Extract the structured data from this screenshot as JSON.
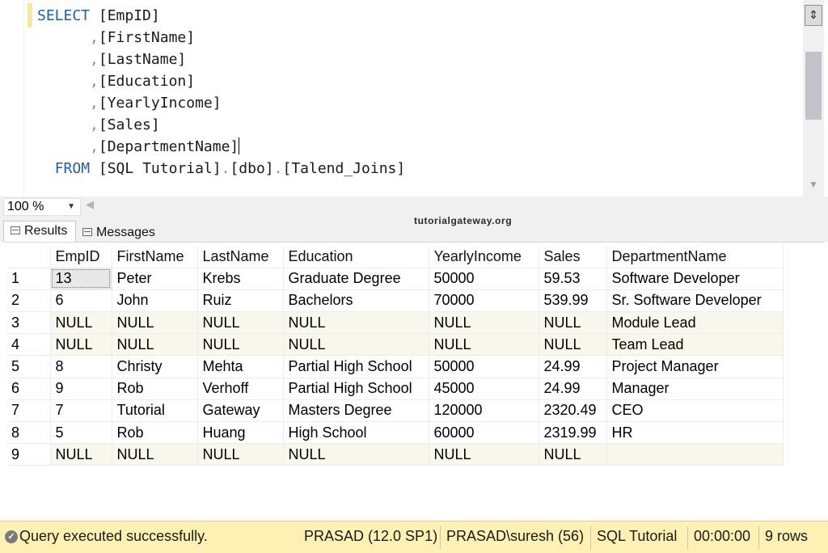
{
  "editor": {
    "lines": [
      [
        {
          "t": "SELECT",
          "c": "kw"
        },
        {
          "t": " [EmpID]",
          "c": ""
        }
      ],
      [
        {
          "t": "      ",
          "c": ""
        },
        {
          "t": ",",
          "c": "punct"
        },
        {
          "t": "[FirstName]",
          "c": ""
        }
      ],
      [
        {
          "t": "      ",
          "c": ""
        },
        {
          "t": ",",
          "c": "punct"
        },
        {
          "t": "[LastName]",
          "c": ""
        }
      ],
      [
        {
          "t": "      ",
          "c": ""
        },
        {
          "t": ",",
          "c": "punct"
        },
        {
          "t": "[Education]",
          "c": ""
        }
      ],
      [
        {
          "t": "      ",
          "c": ""
        },
        {
          "t": ",",
          "c": "punct"
        },
        {
          "t": "[YearlyIncome]",
          "c": ""
        }
      ],
      [
        {
          "t": "      ",
          "c": ""
        },
        {
          "t": ",",
          "c": "punct"
        },
        {
          "t": "[Sales]",
          "c": ""
        }
      ],
      [
        {
          "t": "      ",
          "c": ""
        },
        {
          "t": ",",
          "c": "punct"
        },
        {
          "t": "[DepartmentName]",
          "c": ""
        },
        {
          "t": "",
          "c": "caret"
        }
      ],
      [
        {
          "t": "  ",
          "c": ""
        },
        {
          "t": "FROM",
          "c": "kw"
        },
        {
          "t": " [SQL Tutorial]",
          "c": ""
        },
        {
          "t": ".",
          "c": "punct"
        },
        {
          "t": "[dbo]",
          "c": ""
        },
        {
          "t": ".",
          "c": "punct"
        },
        {
          "t": "[Talend_Joins]",
          "c": ""
        }
      ]
    ]
  },
  "zoom": {
    "value": "100 %"
  },
  "watermark": "tutorialgateway.org",
  "tabs": {
    "results": "Results",
    "messages": "Messages"
  },
  "grid": {
    "columns": [
      "EmpID",
      "FirstName",
      "LastName",
      "Education",
      "YearlyIncome",
      "Sales",
      "DepartmentName"
    ],
    "rows": [
      {
        "n": "1",
        "cells": [
          "13",
          "Peter",
          "Krebs",
          "Graduate Degree",
          "50000",
          "59.53",
          "Software Developer"
        ]
      },
      {
        "n": "2",
        "cells": [
          "6",
          "John",
          "Ruiz",
          "Bachelors",
          "70000",
          "539.99",
          "Sr. Software Developer"
        ]
      },
      {
        "n": "3",
        "cells": [
          "NULL",
          "NULL",
          "NULL",
          "NULL",
          "NULL",
          "NULL",
          "Module Lead"
        ]
      },
      {
        "n": "4",
        "cells": [
          "NULL",
          "NULL",
          "NULL",
          "NULL",
          "NULL",
          "NULL",
          "Team Lead"
        ]
      },
      {
        "n": "5",
        "cells": [
          "8",
          "Christy",
          "Mehta",
          "Partial High School",
          "50000",
          "24.99",
          "Project Manager"
        ]
      },
      {
        "n": "6",
        "cells": [
          "9",
          "Rob",
          "Verhoff",
          "Partial High School",
          "45000",
          "24.99",
          "Manager"
        ]
      },
      {
        "n": "7",
        "cells": [
          "7",
          "Tutorial",
          "Gateway",
          "Masters Degree",
          "120000",
          "2320.49",
          "CEO"
        ]
      },
      {
        "n": "8",
        "cells": [
          "5",
          "Rob",
          "Huang",
          "High School",
          "60000",
          "2319.99",
          "HR"
        ]
      },
      {
        "n": "9",
        "cells": [
          "NULL",
          "NULL",
          "NULL",
          "NULL",
          "NULL",
          "NULL",
          ""
        ]
      }
    ]
  },
  "status": {
    "message": "Query executed successfully.",
    "server": "PRASAD (12.0 SP1)",
    "user": "PRASAD\\suresh (56)",
    "database": "SQL Tutorial",
    "elapsed": "00:00:00",
    "rows": "9 rows"
  }
}
